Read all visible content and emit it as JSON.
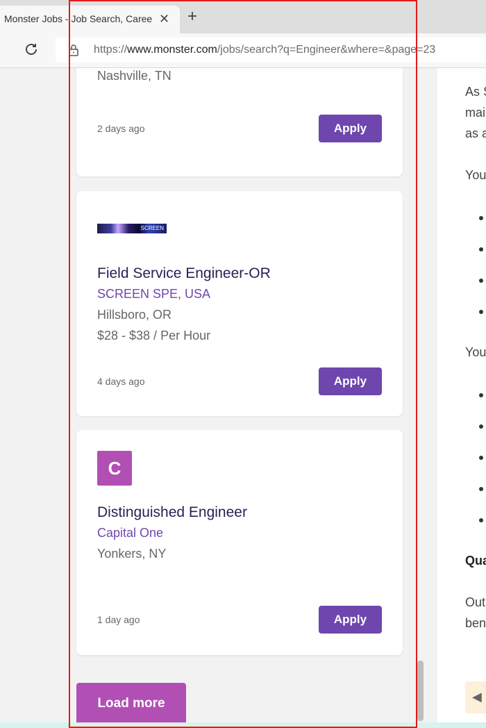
{
  "browser": {
    "tab_title": "Monster Jobs - Job Search, Caree",
    "url_prefix": "https://",
    "url_domain": "www.monster.com",
    "url_path": "/jobs/search?q=Engineer&where=&page=23"
  },
  "jobs": [
    {
      "location": "Nashville, TN",
      "posted": "2 days ago",
      "apply_label": "Apply"
    },
    {
      "logo_text": "SCREEN",
      "title": "Field Service Engineer-OR",
      "company": "SCREEN SPE, USA",
      "location": "Hillsboro, OR",
      "pay": "$28 - $38 / Per Hour",
      "posted": "4 days ago",
      "apply_label": "Apply"
    },
    {
      "logo_letter": "C",
      "title": "Distinguished Engineer",
      "company": "Capital One",
      "location": "Yonkers, NY",
      "posted": "1 day ago",
      "apply_label": "Apply"
    }
  ],
  "load_more_label": "Load more",
  "detail_fragments": {
    "p1_l1": "As S",
    "p1_l2": "mai",
    "p1_l3": "as a",
    "you1": "You",
    "you2": "You",
    "qua": "Qua",
    "out_l1": "Out",
    "out_l2": "ben"
  },
  "colors": {
    "brand_purple": "#6e46ae",
    "load_more": "#b24fb4",
    "title_text": "#2b1d55"
  }
}
